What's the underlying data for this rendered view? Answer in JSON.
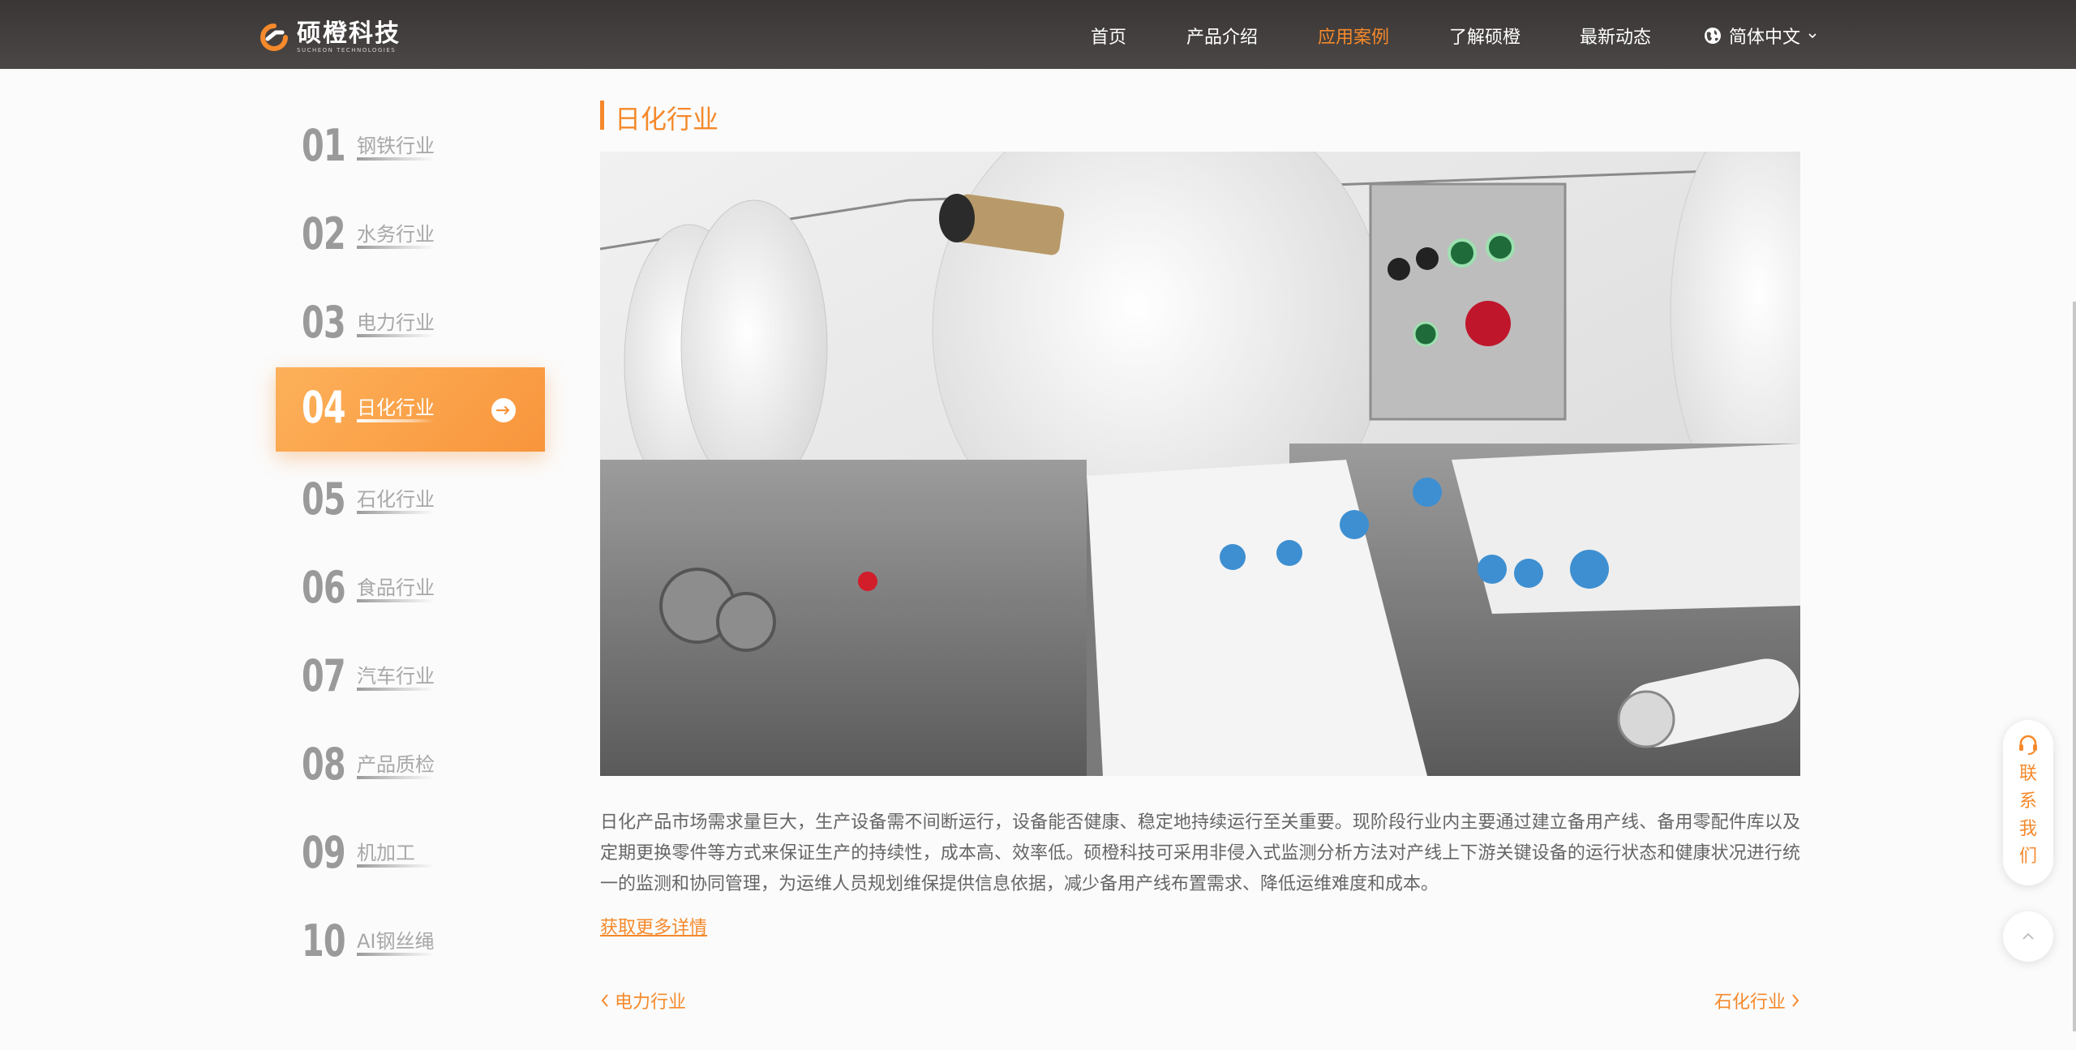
{
  "header": {
    "logo_cn": "硕橙科技",
    "logo_en": "SUCHEON TECHNOLOGIES",
    "nav": [
      {
        "label": "首页",
        "active": false
      },
      {
        "label": "产品介绍",
        "active": false
      },
      {
        "label": "应用案例",
        "active": true
      },
      {
        "label": "了解硕橙",
        "active": false
      },
      {
        "label": "最新动态",
        "active": false
      }
    ],
    "language": "简体中文",
    "globe_icon": "globe-icon",
    "chevron_icon": "chevron-down-icon"
  },
  "sidebar": {
    "items": [
      {
        "num": "01",
        "label": "钢铁行业"
      },
      {
        "num": "02",
        "label": "水务行业"
      },
      {
        "num": "03",
        "label": "电力行业"
      },
      {
        "num": "04",
        "label": "日化行业",
        "active": true
      },
      {
        "num": "05",
        "label": "石化行业"
      },
      {
        "num": "06",
        "label": "食品行业"
      },
      {
        "num": "07",
        "label": "汽车行业"
      },
      {
        "num": "08",
        "label": "产品质检"
      },
      {
        "num": "09",
        "label": "机加工"
      },
      {
        "num": "10",
        "label": "AI钢丝绳"
      }
    ]
  },
  "main": {
    "title": "日化行业",
    "description": "日化产品市场需求量巨大，生产设备需不间断运行，设备能否健康、稳定地持续运行至关重要。现阶段行业内主要通过建立备用产线、备用零配件库以及定期更换零件等方式来保证生产的持续性，成本高、效率低。硕橙科技可采用非侵入式监测分析方法对产线上下游关键设备的运行状态和健康状况进行统一的监测和协同管理，为运维人员规划维保提供信息依据，减少备用产线布置需求、降低运维难度和成本。",
    "more_link": "获取更多详情",
    "prev_label": "电力行业",
    "next_label": "石化行业"
  },
  "floating": {
    "contact_label": "联系我们",
    "contact_icon": "headset-icon",
    "top_icon": "chevron-up-icon"
  },
  "colors": {
    "accent": "#f5892b",
    "header_bg": "#3a3635",
    "sidebar_active": "#f8953c"
  }
}
